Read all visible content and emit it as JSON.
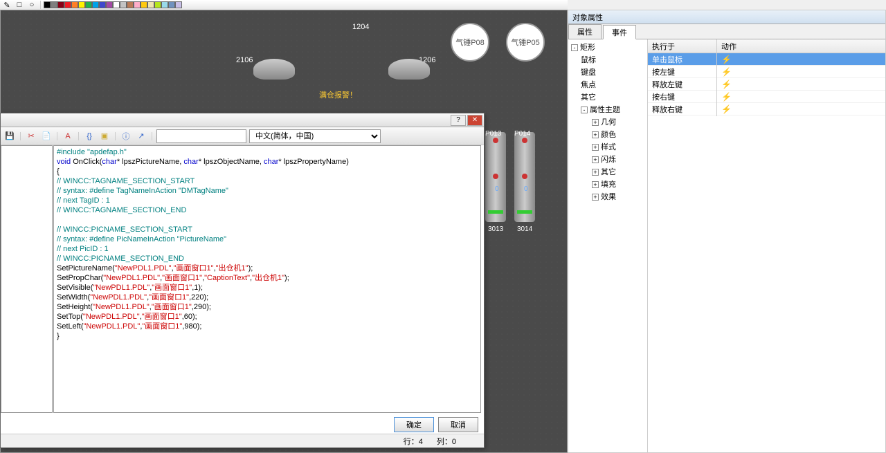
{
  "toolbar": {
    "colors": [
      "#000",
      "#7f7f7f",
      "#880015",
      "#ed1c24",
      "#ff7f27",
      "#fff200",
      "#22b14c",
      "#00a2e8",
      "#3f48cc",
      "#a349a4",
      "#fff",
      "#c3c3c3",
      "#b97a57",
      "#ffaec9",
      "#ffc90e",
      "#efe4b0",
      "#b5e61d",
      "#99d9ea",
      "#7092be",
      "#c8bfe7"
    ]
  },
  "canvas": {
    "label_1204": "1204",
    "label_2106": "2106",
    "label_1206": "1206",
    "circle_p08": "气锤P08",
    "circle_p05": "气锤P05",
    "warning": "满仓报警！",
    "device_3013": "3013",
    "device_3014": "3014",
    "device_p013": "P013",
    "device_p014": "P014",
    "zero": "0"
  },
  "dialog": {
    "lang_label": "中文(简体，中国)",
    "ok": "确定",
    "cancel": "取消",
    "status_row": "行：4",
    "status_col": "列：0",
    "code_lines": [
      {
        "segs": [
          {
            "t": "#include \"apdefap.h\"",
            "c": "c-teal"
          }
        ]
      },
      {
        "segs": [
          {
            "t": "void",
            "c": "c-blue"
          },
          {
            "t": " OnClick(",
            "c": "c-black"
          },
          {
            "t": "char",
            "c": "c-blue"
          },
          {
            "t": "* lpszPictureName, ",
            "c": "c-black"
          },
          {
            "t": "char",
            "c": "c-blue"
          },
          {
            "t": "* lpszObjectName, ",
            "c": "c-black"
          },
          {
            "t": "char",
            "c": "c-blue"
          },
          {
            "t": "* lpszPropertyName)",
            "c": "c-black"
          }
        ]
      },
      {
        "segs": [
          {
            "t": "{",
            "c": "c-black"
          }
        ]
      },
      {
        "segs": [
          {
            "t": "// WINCC:TAGNAME_SECTION_START",
            "c": "c-teal"
          }
        ]
      },
      {
        "segs": [
          {
            "t": "// syntax: #define TagNameInAction \"DMTagName\"",
            "c": "c-teal"
          }
        ]
      },
      {
        "segs": [
          {
            "t": "// next TagID : 1",
            "c": "c-teal"
          }
        ]
      },
      {
        "segs": [
          {
            "t": "// WINCC:TAGNAME_SECTION_END",
            "c": "c-teal"
          }
        ]
      },
      {
        "segs": [
          {
            "t": "",
            "c": "c-black"
          }
        ]
      },
      {
        "segs": [
          {
            "t": "// WINCC:PICNAME_SECTION_START",
            "c": "c-teal"
          }
        ]
      },
      {
        "segs": [
          {
            "t": "// syntax: #define PicNameInAction \"PictureName\"",
            "c": "c-teal"
          }
        ]
      },
      {
        "segs": [
          {
            "t": "// next PicID : 1",
            "c": "c-teal"
          }
        ]
      },
      {
        "segs": [
          {
            "t": "// WINCC:PICNAME_SECTION_END",
            "c": "c-teal"
          }
        ]
      },
      {
        "segs": [
          {
            "t": "SetPictureName(",
            "c": "c-black"
          },
          {
            "t": "\"NewPDL1.PDL\"",
            "c": "c-red"
          },
          {
            "t": ",",
            "c": "c-black"
          },
          {
            "t": "\"画面窗口1\"",
            "c": "c-red"
          },
          {
            "t": ",",
            "c": "c-black"
          },
          {
            "t": "\"出仓机1\"",
            "c": "c-red"
          },
          {
            "t": ");",
            "c": "c-black"
          }
        ]
      },
      {
        "segs": [
          {
            "t": "SetPropChar(",
            "c": "c-black"
          },
          {
            "t": "\"NewPDL1.PDL\"",
            "c": "c-red"
          },
          {
            "t": ",",
            "c": "c-black"
          },
          {
            "t": "\"画面窗口1\"",
            "c": "c-red"
          },
          {
            "t": ",",
            "c": "c-black"
          },
          {
            "t": "\"CaptionText\"",
            "c": "c-red"
          },
          {
            "t": ",",
            "c": "c-black"
          },
          {
            "t": "\"出仓机1\"",
            "c": "c-red"
          },
          {
            "t": ");",
            "c": "c-black"
          }
        ]
      },
      {
        "segs": [
          {
            "t": "SetVisible(",
            "c": "c-black"
          },
          {
            "t": "\"NewPDL1.PDL\"",
            "c": "c-red"
          },
          {
            "t": ",",
            "c": "c-black"
          },
          {
            "t": "\"画面窗口1\"",
            "c": "c-red"
          },
          {
            "t": ",1);",
            "c": "c-black"
          }
        ]
      },
      {
        "segs": [
          {
            "t": "SetWidth(",
            "c": "c-black"
          },
          {
            "t": "\"NewPDL1.PDL\"",
            "c": "c-red"
          },
          {
            "t": ",",
            "c": "c-black"
          },
          {
            "t": "\"画面窗口1\"",
            "c": "c-red"
          },
          {
            "t": ",220);",
            "c": "c-black"
          }
        ]
      },
      {
        "segs": [
          {
            "t": "SetHeight(",
            "c": "c-black"
          },
          {
            "t": "\"NewPDL1.PDL\"",
            "c": "c-red"
          },
          {
            "t": ",",
            "c": "c-black"
          },
          {
            "t": "\"画面窗口1\"",
            "c": "c-red"
          },
          {
            "t": ",290);",
            "c": "c-black"
          }
        ]
      },
      {
        "segs": [
          {
            "t": "SetTop(",
            "c": "c-black"
          },
          {
            "t": "\"NewPDL1.PDL\"",
            "c": "c-red"
          },
          {
            "t": ",",
            "c": "c-black"
          },
          {
            "t": "\"画面窗口1\"",
            "c": "c-red"
          },
          {
            "t": ",60);",
            "c": "c-black"
          }
        ]
      },
      {
        "segs": [
          {
            "t": "SetLeft(",
            "c": "c-black"
          },
          {
            "t": "\"NewPDL1.PDL\"",
            "c": "c-red"
          },
          {
            "t": ",",
            "c": "c-black"
          },
          {
            "t": "\"画面窗口1\"",
            "c": "c-red"
          },
          {
            "t": ",980);",
            "c": "c-black"
          }
        ]
      },
      {
        "segs": [
          {
            "t": "}",
            "c": "c-black"
          }
        ]
      }
    ]
  },
  "props": {
    "title": "对象属性",
    "tab_attr": "属性",
    "tab_event": "事件",
    "tree": [
      {
        "label": "矩形",
        "indent": 0,
        "exp": "-"
      },
      {
        "label": "鼠标",
        "indent": 1
      },
      {
        "label": "键盘",
        "indent": 1
      },
      {
        "label": "焦点",
        "indent": 1
      },
      {
        "label": "其它",
        "indent": 1
      },
      {
        "label": "属性主题",
        "indent": 1,
        "exp": "-"
      },
      {
        "label": "几何",
        "indent": 2,
        "exp": "+"
      },
      {
        "label": "颜色",
        "indent": 2,
        "exp": "+"
      },
      {
        "label": "样式",
        "indent": 2,
        "exp": "+"
      },
      {
        "label": "闪烁",
        "indent": 2,
        "exp": "+"
      },
      {
        "label": "其它",
        "indent": 2,
        "exp": "+"
      },
      {
        "label": "填充",
        "indent": 2,
        "exp": "+"
      },
      {
        "label": "效果",
        "indent": 2,
        "exp": "+"
      }
    ],
    "col_exec": "执行于",
    "col_action": "动作",
    "events": [
      {
        "label": "单击鼠标",
        "selected": true,
        "has": true
      },
      {
        "label": "按左键",
        "selected": false,
        "has": false
      },
      {
        "label": "释放左键",
        "selected": false,
        "has": false
      },
      {
        "label": "按右键",
        "selected": false,
        "has": false
      },
      {
        "label": "释放右键",
        "selected": false,
        "has": false
      }
    ]
  }
}
